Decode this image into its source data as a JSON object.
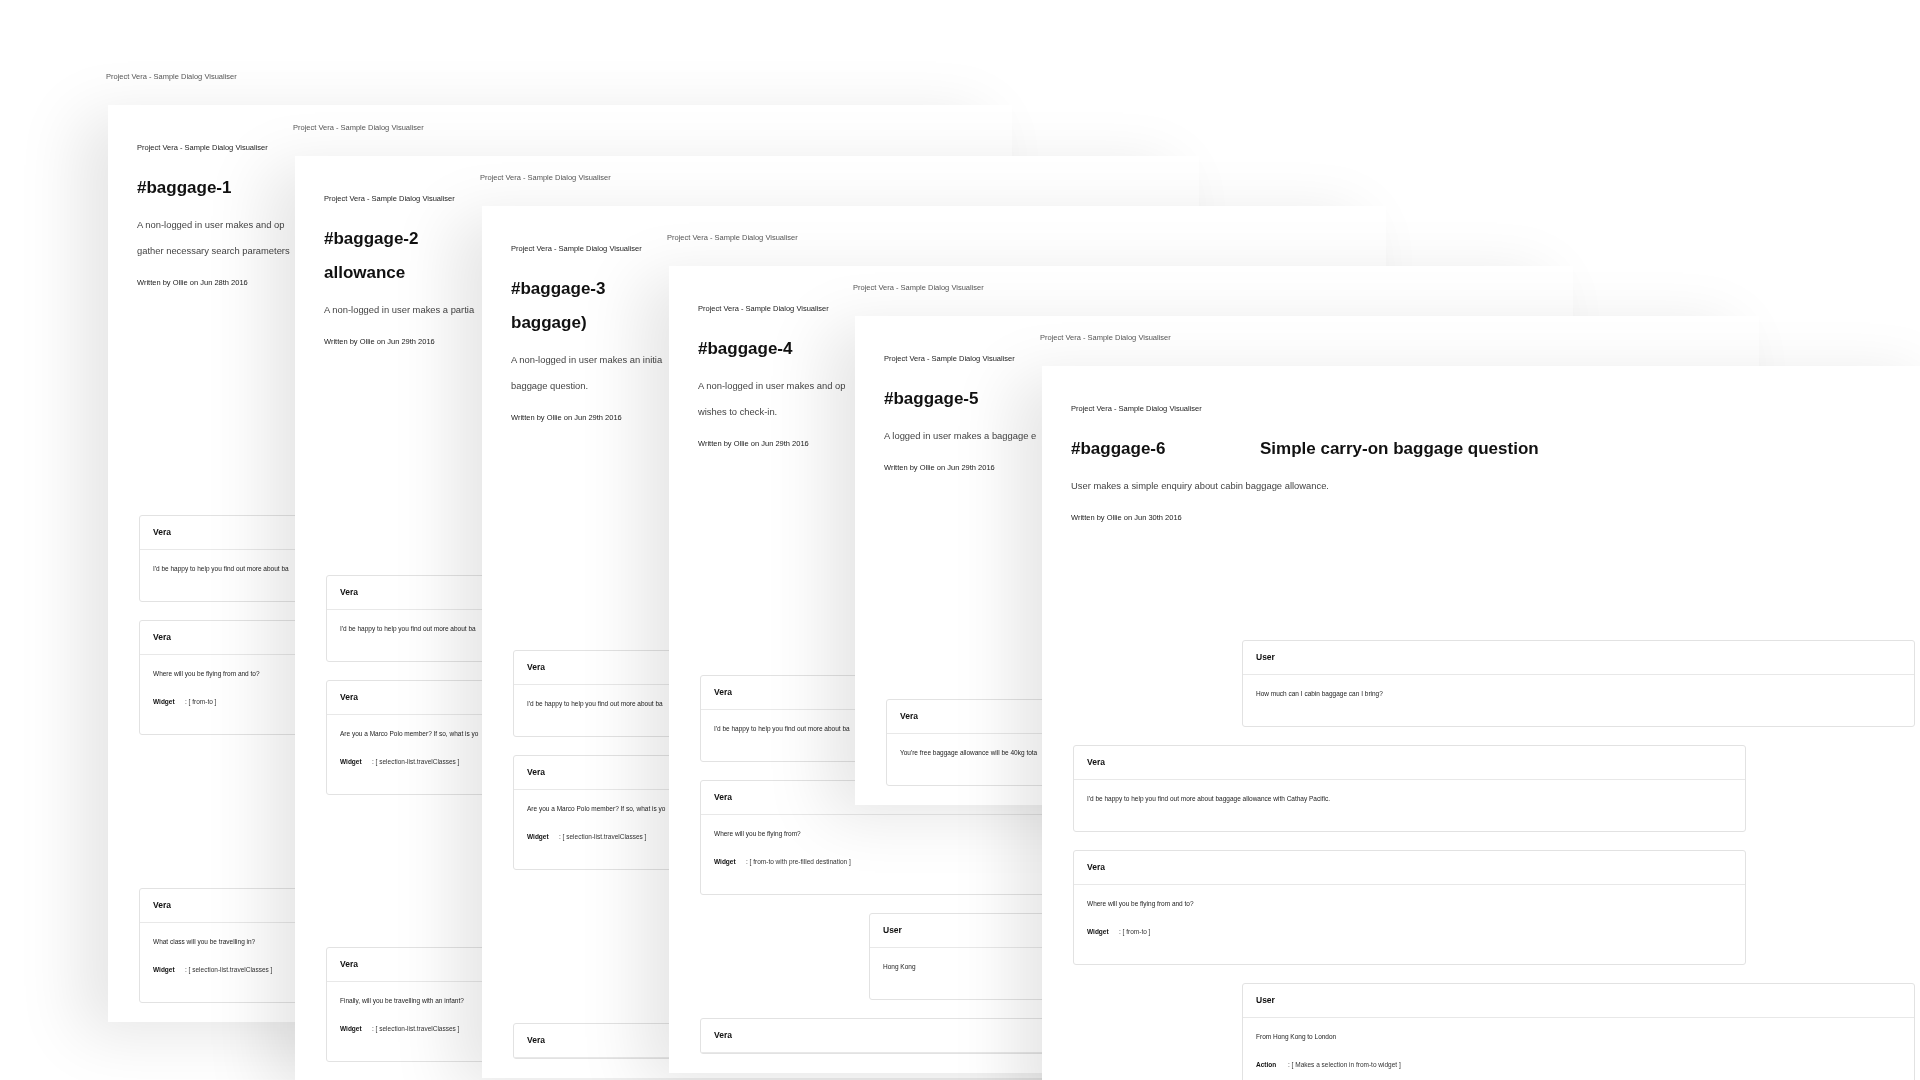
{
  "pages": [
    {
      "print_header": "Project Vera - Sample Dialog Visualiser",
      "header": "Project Vera - Sample Dialog Visualiser",
      "id": "#baggage-1",
      "description": [
        "A non-logged in user makes and op",
        "gather necessary search parameters"
      ],
      "author": "Written by Ollie on Jun 28th 2016",
      "messages": [
        {
          "kind": "bot",
          "speaker": "Vera",
          "text": "I'd be happy to help you find out more about ba"
        },
        {
          "kind": "bot",
          "speaker": "Vera",
          "text": "Where will you be flying from and to?",
          "detail": {
            "label": "Widget",
            "value": ": [ from-to ]"
          }
        },
        {
          "kind": "bot",
          "speaker": "Vera",
          "text": "What class will you be travelling in?",
          "detail": {
            "label": "Widget",
            "value": ": [ selection-list.travelClasses ]"
          }
        }
      ]
    },
    {
      "print_header": "Project Vera - Sample Dialog Visualiser",
      "header": "Project Vera - Sample Dialog Visualiser",
      "id": "#baggage-2",
      "title_tail": "allowance",
      "description": [
        "A non-logged in user makes a partia"
      ],
      "author": "Written by Ollie on Jun 29th 2016",
      "messages": [
        {
          "kind": "bot",
          "speaker": "Vera",
          "text": "I'd be happy to help you find out more about ba"
        },
        {
          "kind": "bot",
          "speaker": "Vera",
          "text": "Are you a Marco Polo member? If so, what is yo",
          "detail": {
            "label": "Widget",
            "value": ": [ selection-list.travelClasses ]"
          }
        },
        {
          "kind": "bot",
          "speaker": "Vera",
          "text": "Finally, will you be travelling with an infant?",
          "detail": {
            "label": "Widget",
            "value": ": [ selection-list.travelClasses ]"
          }
        }
      ]
    },
    {
      "print_header": "Project Vera - Sample Dialog Visualiser",
      "header": "Project Vera - Sample Dialog Visualiser",
      "id": "#baggage-3",
      "title_tail": "baggage)",
      "description": [
        "A non-logged in user makes an initia",
        "baggage question."
      ],
      "author": "Written by Ollie on Jun 29th 2016",
      "messages": [
        {
          "kind": "bot",
          "speaker": "Vera",
          "text": "I'd be happy to help you find out more about ba"
        },
        {
          "kind": "bot",
          "speaker": "Vera",
          "text": "Are you a Marco Polo member? If so, what is yo",
          "detail": {
            "label": "Widget",
            "value": ": [ selection-list.travelClasses ]"
          }
        },
        {
          "kind": "bot",
          "speaker": "Vera"
        }
      ]
    },
    {
      "print_header": "Project Vera - Sample Dialog Visualiser",
      "header": "Project Vera - Sample Dialog Visualiser",
      "id": "#baggage-4",
      "description": [
        "A non-logged in user makes and op",
        "wishes to check-in."
      ],
      "author": "Written by Ollie on Jun 29th 2016",
      "messages": [
        {
          "kind": "bot",
          "speaker": "Vera",
          "text": "I'd be happy to help you find out more about ba"
        },
        {
          "kind": "bot",
          "speaker": "Vera",
          "text": "Where will you be flying from?",
          "detail": {
            "label": "Widget",
            "value": ": [ from-to with pre-filled destination ]"
          }
        },
        {
          "kind": "user",
          "speaker": "User",
          "text": "Hong Kong"
        },
        {
          "kind": "bot",
          "speaker": "Vera"
        }
      ]
    },
    {
      "print_header": "Project Vera - Sample Dialog Visualiser",
      "header": "Project Vera - Sample Dialog Visualiser",
      "id": "#baggage-5",
      "description": [
        "A logged in user makes a baggage e"
      ],
      "author": "Written by Ollie on Jun 29th 2016",
      "messages": [
        {
          "kind": "bot",
          "speaker": "Vera",
          "text": "You're free baggage allowance will be 40kg tota"
        }
      ]
    },
    {
      "print_header": "Project Vera - Sample Dialog Visualiser",
      "header": "Project Vera - Sample Dialog Visualiser",
      "id": "#baggage-6",
      "title": "Simple carry-on baggage question",
      "description": [
        "User makes a simple enquiry about cabin baggage allowance."
      ],
      "author": "Written by Ollie on Jun 30th 2016",
      "messages": [
        {
          "kind": "user",
          "speaker": "User",
          "text": "How much can I cabin baggage can I bring?"
        },
        {
          "kind": "bot",
          "speaker": "Vera",
          "text": "I'd be happy to help you find out more about baggage allowance with Cathay Pacific."
        },
        {
          "kind": "bot",
          "speaker": "Vera",
          "text": "Where will you be flying from and to?",
          "detail": {
            "label": "Widget",
            "value": ": [ from-to ]"
          }
        },
        {
          "kind": "user",
          "speaker": "User",
          "text": "From Hong Kong to London",
          "detail": {
            "label": "Action",
            "value": ": [ Makes a selection in from-to widget ]"
          }
        }
      ]
    }
  ]
}
